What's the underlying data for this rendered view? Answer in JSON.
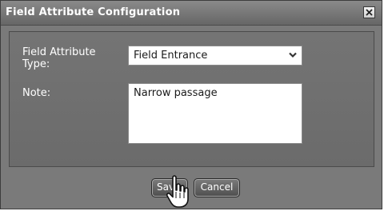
{
  "dialog": {
    "title": "Field Attribute Configuration",
    "close_icon": "close-icon"
  },
  "form": {
    "type_label": "Field Attribute Type:",
    "type_value": "Field Entrance",
    "note_label": "Note:",
    "note_value": "Narrow passage"
  },
  "buttons": {
    "save_label": "Save",
    "cancel_label": "Cancel"
  },
  "cursor": "hand-pointer-icon",
  "colors": {
    "dialog_bg": "#7a7a7a",
    "titlebar": "#666666",
    "button": "#4e4e4e"
  }
}
